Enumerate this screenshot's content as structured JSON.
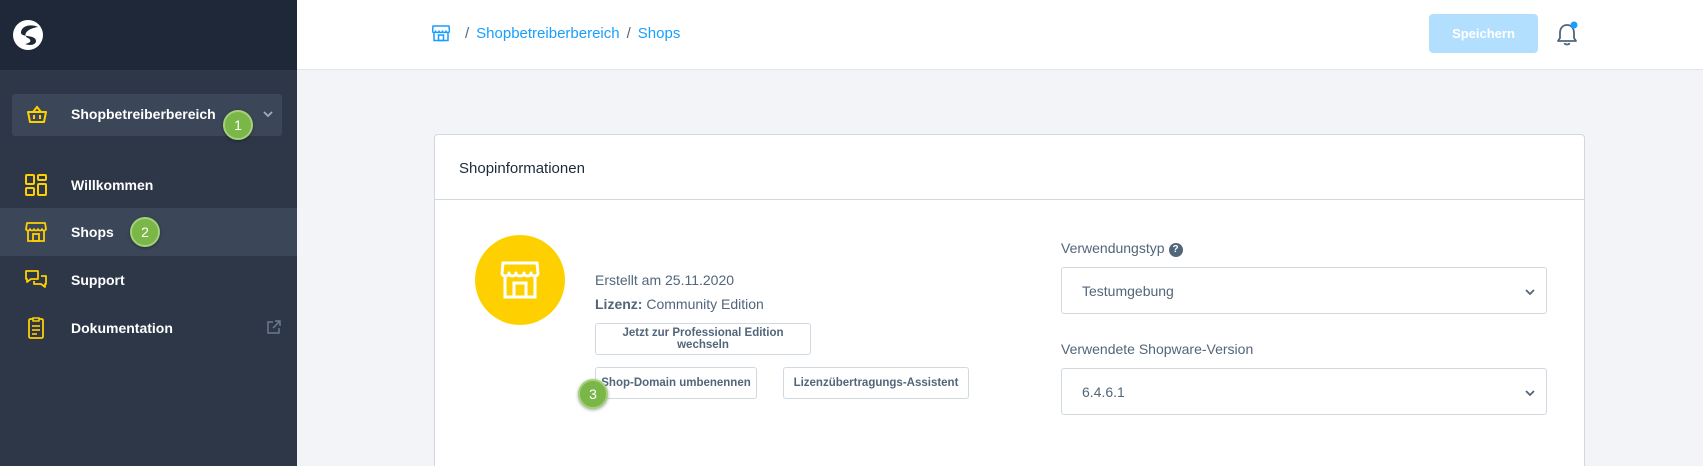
{
  "sidebar": {
    "logo_icon": "shopware-logo-icon",
    "switcher": {
      "label": "Shopbetreiberbereich",
      "icon": "basket-icon"
    },
    "items": [
      {
        "label": "Willkommen",
        "icon": "dashboard-icon"
      },
      {
        "label": "Shops",
        "icon": "storefront-icon",
        "active": true
      },
      {
        "label": "Support",
        "icon": "chat-icon"
      },
      {
        "label": "Dokumentation",
        "icon": "document-icon",
        "external_icon": "external-link-icon"
      }
    ]
  },
  "badges": [
    "1",
    "2",
    "3"
  ],
  "header": {
    "breadcrumb": [
      "Shopbetreiberbereich",
      "Shops"
    ],
    "save_label": "Speichern"
  },
  "card": {
    "title": "Shopinformationen",
    "created": "Erstellt am 25.11.2020",
    "license_label": "Lizenz:",
    "license_value": "Community Edition",
    "buttons": {
      "upgrade": "Jetzt zur Professional Edition wechseln",
      "rename": "Shop-Domain umbenennen",
      "transfer": "Lizenzübertragungs-Assistent"
    },
    "usage_label": "Verwendungstyp",
    "help_glyph": "?",
    "usage_value": "Testumgebung",
    "version_label": "Verwendete Shopware-Version",
    "version_value": "6.4.6.1"
  },
  "colors": {
    "accent": "#189eff",
    "icon_yellow": "#ffd000",
    "sidebar_bg": "#2d3748",
    "badge_green": "#7ab648"
  }
}
